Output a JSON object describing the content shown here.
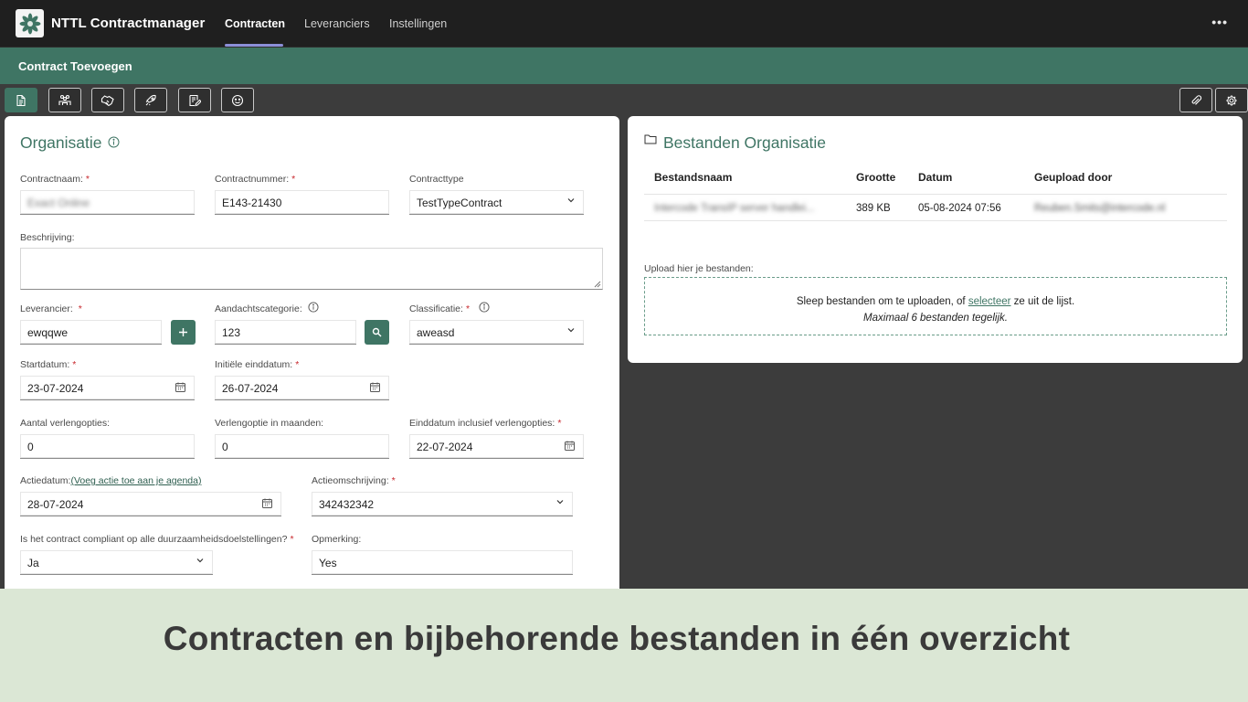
{
  "app": {
    "title": "NTTL Contractmanager",
    "logo_icon": "leaf-logo-icon"
  },
  "nav": {
    "items": [
      {
        "label": "Contracten",
        "active": true
      },
      {
        "label": "Leveranciers",
        "active": false
      },
      {
        "label": "Instellingen",
        "active": false
      }
    ],
    "more": "•••"
  },
  "page": {
    "title": "Contract Toevoegen"
  },
  "toolbar": {
    "left_icons": [
      "document-icon",
      "team-icon",
      "handshake-icon",
      "rocket-icon",
      "edit-note-icon",
      "smiley-icon"
    ],
    "right_icons": [
      "paperclip-icon",
      "gear-icon"
    ],
    "active_index": 0
  },
  "organisatie": {
    "title": "Organisatie",
    "contractnaam": {
      "label": "Contractnaam:",
      "required": "*",
      "value": "Exact Online"
    },
    "contractnummer": {
      "label": "Contractnummer:",
      "required": "*",
      "value": "E143-21430"
    },
    "contracttype": {
      "label": "Contracttype",
      "value": "TestTypeContract"
    },
    "beschrijving": {
      "label": "Beschrijving:",
      "value": ""
    },
    "leverancier": {
      "label": "Leverancier:",
      "required": "*",
      "value": "ewqqwe"
    },
    "aandachtscategorie": {
      "label": "Aandachtscategorie:",
      "value": "123"
    },
    "classificatie": {
      "label": "Classificatie:",
      "required": "*",
      "value": "aweasd"
    },
    "startdatum": {
      "label": "Startdatum:",
      "required": "*",
      "value": "23-07-2024"
    },
    "initiele_einddatum": {
      "label": "Initiële einddatum:",
      "required": "*",
      "value": "26-07-2024"
    },
    "aantal_verlengopties": {
      "label": "Aantal verlengopties:",
      "value": "0"
    },
    "verlengoptie_maanden": {
      "label": "Verlengoptie in maanden:",
      "value": "0"
    },
    "einddatum_incl": {
      "label": "Einddatum inclusief verlengopties:",
      "required": "*",
      "value": "22-07-2024"
    },
    "actiedatum": {
      "label": "Actiedatum:",
      "link": "(Voeg actie toe aan je agenda)",
      "value": "28-07-2024"
    },
    "actieomschrijving": {
      "label": "Actieomschrijving:",
      "required": "*",
      "value": "342432342"
    },
    "compliant": {
      "label": "Is het contract compliant op alle duurzaamheidsdoelstellingen?",
      "required": "*",
      "value": "Ja"
    },
    "opmerking": {
      "label": "Opmerking:",
      "value": "Yes"
    }
  },
  "bestanden": {
    "title": "Bestanden Organisatie",
    "columns": [
      "Bestandsnaam",
      "Grootte",
      "Datum",
      "Geupload door"
    ],
    "rows": [
      {
        "name": "Intercode TransIP server handlei...",
        "size": "389 KB",
        "date": "05-08-2024 07:56",
        "uploader": "Reuben.Smits@intercode.nl"
      }
    ],
    "upload_label": "Upload hier je bestanden:",
    "dropzone_before": "Sleep bestanden om te uploaden, of ",
    "dropzone_link": "selecteer",
    "dropzone_after": " ze uit de lijst.",
    "dropzone_hint": "Maximaal 6 bestanden tegelijk."
  },
  "caption": {
    "text": "Contracten en bijbehorende bestanden in één overzicht"
  },
  "colors": {
    "brand_green": "#3f7564",
    "nav_accent": "#8c8fd8",
    "caption_bg": "#dbe7d5",
    "required": "#c8282d"
  }
}
